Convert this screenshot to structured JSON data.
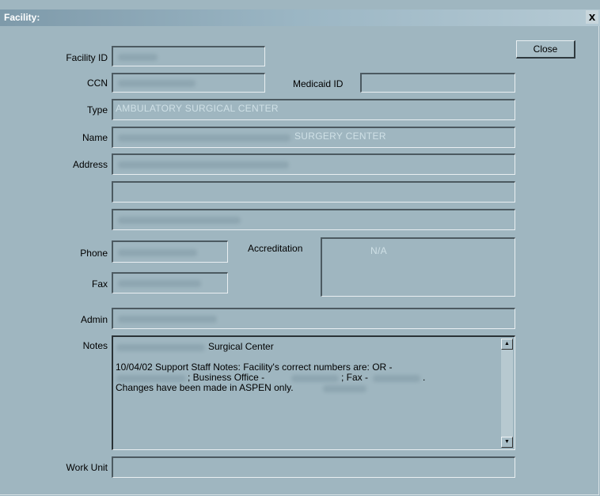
{
  "window": {
    "title": "Facility:",
    "close_glyph": "x"
  },
  "buttons": {
    "close": "Close"
  },
  "labels": {
    "facility_id": "Facility ID",
    "ccn": "CCN",
    "medicaid_id": "Medicaid ID",
    "type": "Type",
    "name": "Name",
    "address": "Address",
    "phone": "Phone",
    "accreditation": "Accreditation",
    "fax": "Fax",
    "admin": "Admin",
    "notes": "Notes",
    "work_unit": "Work Unit"
  },
  "fields": {
    "type": "AMBULATORY SURGICAL CENTER",
    "name_suffix": "SURGERY CENTER",
    "accreditation": "N/A",
    "notes_line1": "Surgical Center",
    "notes_line2a": "10/04/02 Support Staff Notes:  Facility's correct numbers are:  OR -",
    "notes_line2b": "; Business Office -",
    "notes_line2c": "; Fax -",
    "notes_line2d": ".",
    "notes_line3": "Changes have been made in ASPEN only."
  },
  "icons": {
    "scroll_up": "scroll-up-arrow-icon",
    "scroll_down": "scroll-down-arrow-icon"
  }
}
